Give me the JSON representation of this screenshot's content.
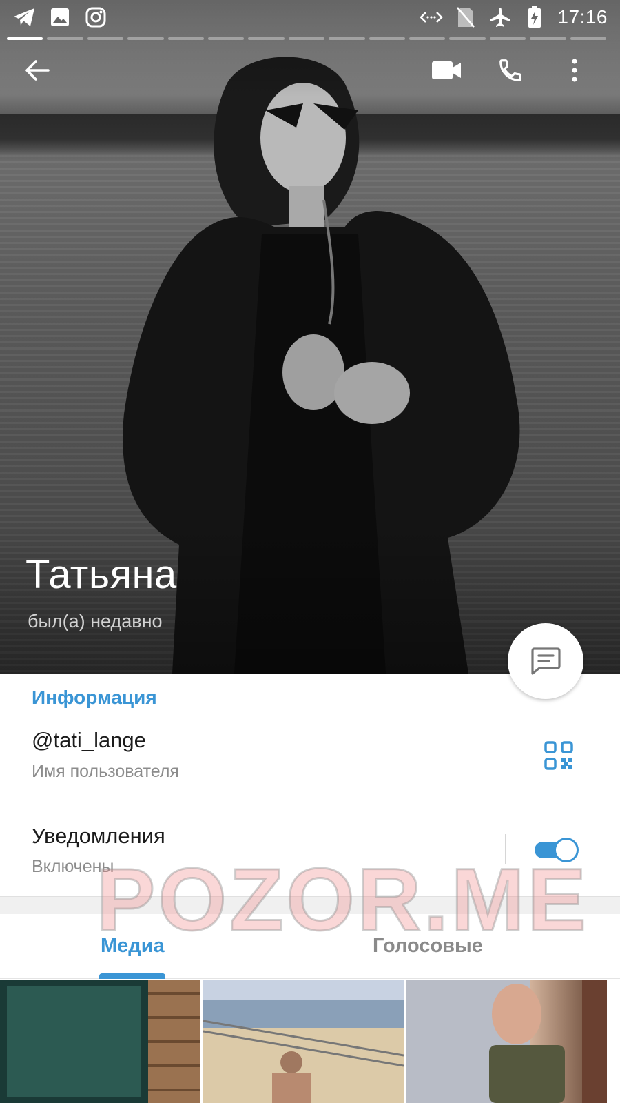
{
  "status_bar": {
    "time": "17:16",
    "left_icons": [
      "telegram-icon",
      "gallery-icon",
      "instagram-icon"
    ],
    "right_icons": [
      "data-transfer-icon",
      "no-sim-icon",
      "airplane-icon",
      "battery-charging-icon"
    ]
  },
  "story_progress": {
    "segments": 15,
    "active_index": 0
  },
  "toolbar": {
    "back_icon": "arrow-left-icon",
    "actions": [
      "video-call-icon",
      "phone-icon",
      "more-vert-icon"
    ]
  },
  "profile": {
    "name": "Татьяна",
    "last_seen": "был(а) недавно"
  },
  "fab": {
    "icon": "message-icon"
  },
  "info": {
    "section_title": "Информация",
    "username": "@tati_lange",
    "username_label": "Имя пользователя",
    "qr_icon": "qr-code-icon",
    "notifications": "Уведомления",
    "notifications_state": "Включены",
    "notifications_enabled": true
  },
  "tabs": {
    "media": "Медиа",
    "voice": "Голосовые",
    "selected": "Медиа"
  },
  "media_grid": {
    "visible_thumbnails": 3
  },
  "watermark": "POZOR.ME",
  "colors": {
    "accent": "#3a95d5",
    "secondary_text": "#8c8c8c",
    "primary_text": "#1b1b1b"
  }
}
